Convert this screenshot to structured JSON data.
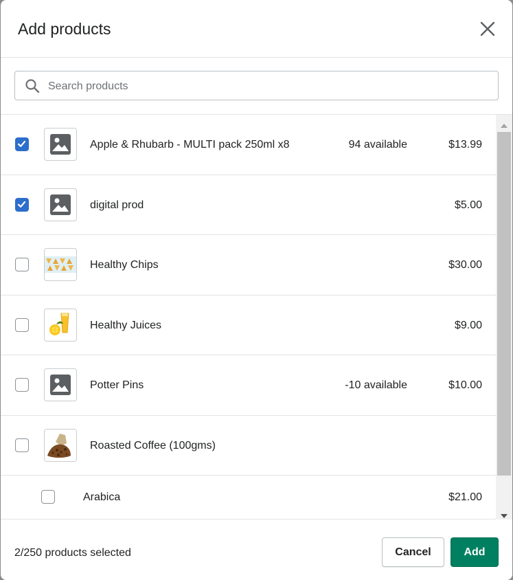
{
  "modal": {
    "title": "Add products",
    "close_icon": "close-icon"
  },
  "search": {
    "placeholder": "Search products",
    "icon": "search-icon"
  },
  "products": [
    {
      "name": "Apple & Rhubarb - MULTI pack 250ml x8",
      "available": "94 available",
      "price": "$13.99",
      "checked": true,
      "thumb": "image-placeholder-icon"
    },
    {
      "name": "digital prod",
      "available": "",
      "price": "$5.00",
      "checked": true,
      "thumb": "image-placeholder-icon"
    },
    {
      "name": "Healthy Chips",
      "available": "",
      "price": "$30.00",
      "checked": false,
      "thumb": "chips-photo"
    },
    {
      "name": "Healthy Juices",
      "available": "",
      "price": "$9.00",
      "checked": false,
      "thumb": "juice-photo"
    },
    {
      "name": "Potter Pins",
      "available": "-10 available",
      "price": "$10.00",
      "checked": false,
      "thumb": "image-placeholder-icon"
    },
    {
      "name": "Roasted Coffee (100gms)",
      "available": "",
      "price": "",
      "checked": false,
      "thumb": "coffee-photo"
    }
  ],
  "variants": [
    {
      "name": "Arabica",
      "price": "$21.00",
      "checked": false
    }
  ],
  "footer": {
    "selected_count": "2/250 products selected",
    "cancel_label": "Cancel",
    "add_label": "Add"
  },
  "colors": {
    "checkbox_checked": "#2c6ecb",
    "primary_button": "#008060"
  }
}
